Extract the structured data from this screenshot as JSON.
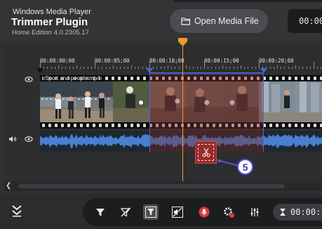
{
  "app": {
    "subtitle": "Windows Media Player",
    "title": "Trimmer Plugin",
    "edition": "Home Edition 4.0.2305.17"
  },
  "toolbar_top": {
    "open_label": "Open Media File",
    "time": "00:00"
  },
  "ruler": {
    "labels": [
      "00:00:00;00",
      "00:00:05;00",
      "00:00:10;00",
      "00:00:15;00",
      "00:00:20;00"
    ]
  },
  "timeline": {
    "clip_name": "Sport and people.mp4",
    "callout_number": "5"
  },
  "bottom": {
    "time": "00:00:"
  },
  "colors": {
    "accent_blue": "#4467dd",
    "playhead_orange": "#f29a2e",
    "cut_red": "#9b2a2a",
    "record_red": "#d93b3b"
  },
  "icons": [
    "eye-icon",
    "speaker-icon",
    "folder-icon",
    "scissors-icon",
    "filter-icon",
    "filter-off-icon",
    "mute-video-icon",
    "microphone-icon",
    "settings-icon",
    "equalizer-icon",
    "hourglass-icon",
    "collapse-icon",
    "chevron-left-icon"
  ]
}
